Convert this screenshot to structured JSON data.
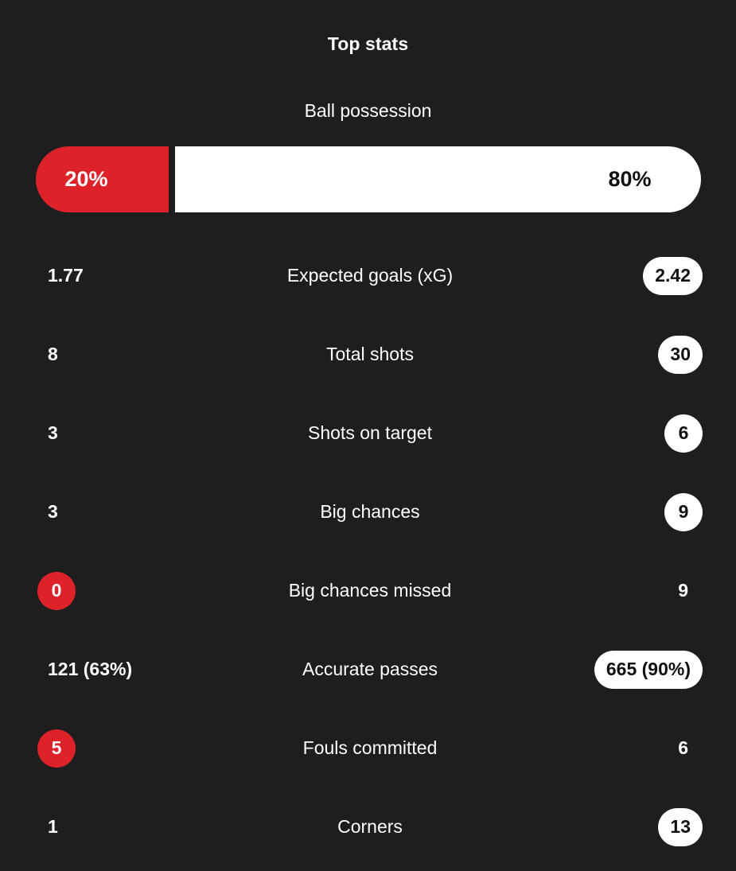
{
  "header": {
    "title": "Top stats"
  },
  "possession": {
    "label": "Ball possession",
    "home_value": "20%",
    "away_value": "80%",
    "home_pct": 20,
    "away_pct": 80,
    "home_color": "#dd2329",
    "away_color": "#ffffff"
  },
  "theme": {
    "background": "#1e1e1e",
    "accent_red": "#dd2329",
    "pill_white": "#ffffff",
    "text_primary": "#ffffff",
    "text_on_white": "#111111"
  },
  "stats": [
    {
      "label": "Expected goals (xG)",
      "home": {
        "value": "1.77",
        "highlight": "none"
      },
      "away": {
        "value": "2.42",
        "highlight": "white"
      }
    },
    {
      "label": "Total shots",
      "home": {
        "value": "8",
        "highlight": "none"
      },
      "away": {
        "value": "30",
        "highlight": "white"
      }
    },
    {
      "label": "Shots on target",
      "home": {
        "value": "3",
        "highlight": "none"
      },
      "away": {
        "value": "6",
        "highlight": "white"
      }
    },
    {
      "label": "Big chances",
      "home": {
        "value": "3",
        "highlight": "none"
      },
      "away": {
        "value": "9",
        "highlight": "white"
      }
    },
    {
      "label": "Big chances missed",
      "home": {
        "value": "0",
        "highlight": "red"
      },
      "away": {
        "value": "9",
        "highlight": "none"
      }
    },
    {
      "label": "Accurate passes",
      "home": {
        "value": "121 (63%)",
        "highlight": "none"
      },
      "away": {
        "value": "665 (90%)",
        "highlight": "white"
      }
    },
    {
      "label": "Fouls committed",
      "home": {
        "value": "5",
        "highlight": "red"
      },
      "away": {
        "value": "6",
        "highlight": "none"
      }
    },
    {
      "label": "Corners",
      "home": {
        "value": "1",
        "highlight": "none"
      },
      "away": {
        "value": "13",
        "highlight": "white"
      }
    }
  ]
}
